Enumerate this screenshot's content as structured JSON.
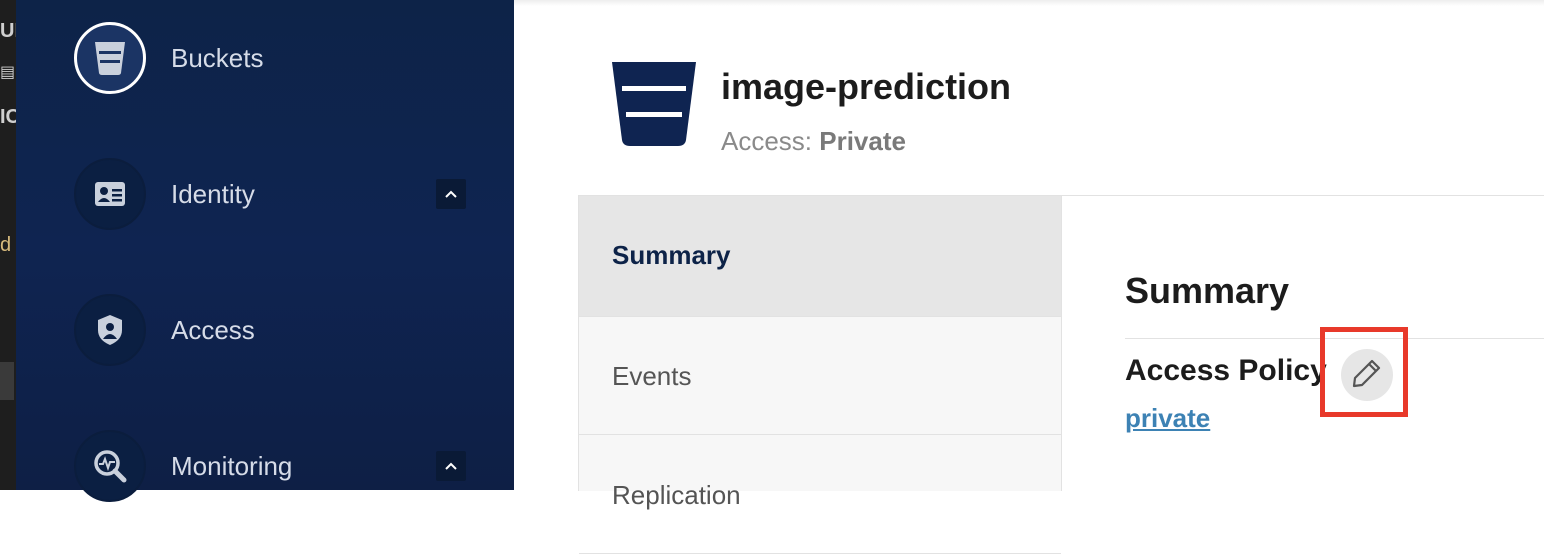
{
  "edge": {
    "chars": [
      "UI",
      "▤",
      "IC",
      "d"
    ]
  },
  "sidebar": {
    "items": [
      {
        "label": "Buckets",
        "icon": "bucket-icon",
        "active": true
      },
      {
        "label": "Identity",
        "icon": "id-card-icon",
        "expandable": true
      },
      {
        "label": "Access",
        "icon": "lock-shield-icon"
      },
      {
        "label": "Monitoring",
        "icon": "magnify-pulse-icon",
        "expandable": true
      }
    ]
  },
  "header": {
    "title": "image-prediction",
    "access_prefix": "Access: ",
    "access_value": "Private"
  },
  "tabs": [
    {
      "label": "Summary",
      "active": true
    },
    {
      "label": "Events"
    },
    {
      "label": "Replication"
    }
  ],
  "summary": {
    "title": "Summary",
    "access_policy_label": "Access Policy",
    "access_policy_value": "private"
  },
  "colors": {
    "sidebar_bg": "#0f2451",
    "highlight": "#e8392a",
    "link": "#3d82b4"
  }
}
